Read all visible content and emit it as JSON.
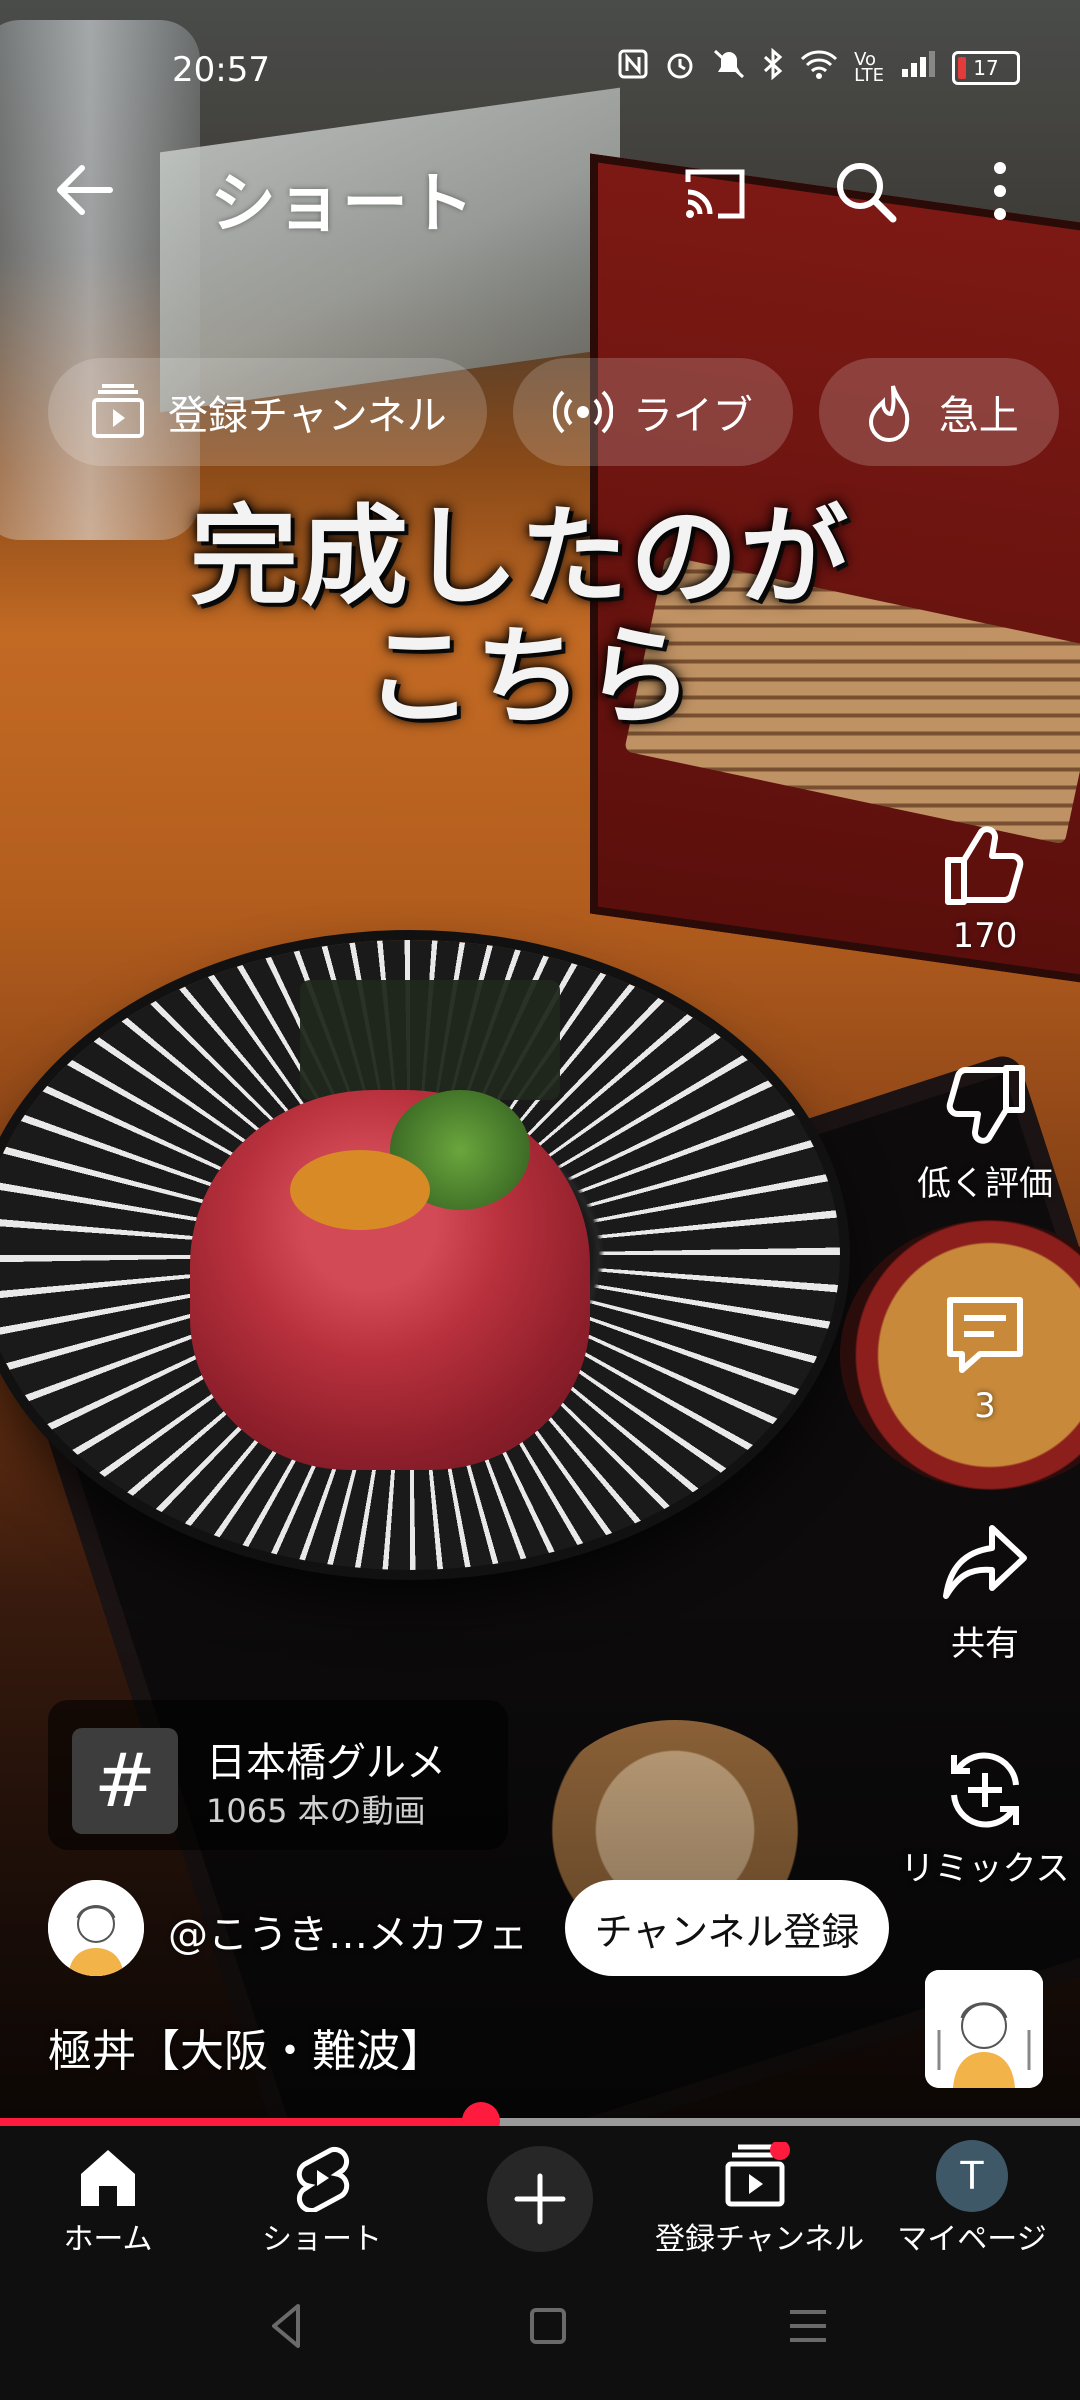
{
  "status_bar": {
    "time": "20:57",
    "icons": [
      "nfc-icon",
      "alarm-icon",
      "mute-icon",
      "bluetooth-icon",
      "wifi-icon",
      "volte-icon",
      "signal-icon"
    ],
    "battery": "17"
  },
  "app_bar": {
    "title": "ショート",
    "back_icon": "arrow-left-icon",
    "cast_icon": "cast-icon",
    "search_icon": "search-icon",
    "more_icon": "more-vert-icon"
  },
  "chips": [
    {
      "label": "登録チャンネル",
      "icon": "subscriptions-icon"
    },
    {
      "label": "ライブ",
      "icon": "live-icon"
    },
    {
      "label": "急上",
      "icon": "trending-icon"
    }
  ],
  "caption": {
    "line1": "完成したのが",
    "line2": "こちら"
  },
  "actions": {
    "like": {
      "label": "170",
      "icon": "thumb-up-icon"
    },
    "dislike": {
      "label": "低く評価",
      "icon": "thumb-down-icon"
    },
    "comments": {
      "label": "3",
      "icon": "comment-icon"
    },
    "share": {
      "label": "共有",
      "icon": "share-icon"
    },
    "remix": {
      "label": "リミックス",
      "icon": "remix-icon"
    }
  },
  "hashtag": {
    "symbol": "#",
    "title": "日本橋グルメ",
    "subtitle": "1065 本の動画"
  },
  "channel": {
    "handle": "@こうき…メカフェ",
    "subscribe_label": "チャンネル登録"
  },
  "video": {
    "title": "極丼【大阪・難波】",
    "progress": 0.445
  },
  "bottom_nav": [
    {
      "label": "ホーム",
      "icon": "home-icon"
    },
    {
      "label": "ショート",
      "icon": "shorts-icon"
    },
    {
      "label": "",
      "icon": "plus-icon"
    },
    {
      "label": "登録チャンネル",
      "icon": "subscriptions-icon"
    },
    {
      "label": "マイページ",
      "icon": "avatar-icon",
      "avatar_letter": "T"
    }
  ],
  "colors": {
    "accent_red": "#ff1b3d",
    "nav_bg": "#0f0f0f",
    "avatar_bg": "#3e5868"
  }
}
